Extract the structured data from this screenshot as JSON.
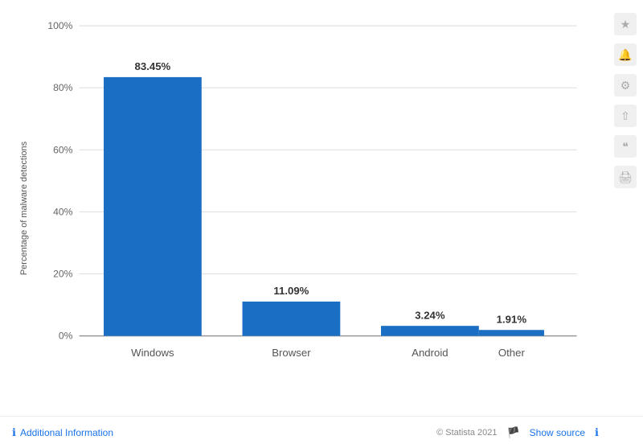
{
  "chart": {
    "title": "Percentage of malware detections",
    "y_axis_label": "Percentage of malware detections",
    "y_axis_ticks": [
      "0%",
      "20%",
      "40%",
      "60%",
      "80%",
      "100%"
    ],
    "bars": [
      {
        "label": "Windows",
        "value": 83.45,
        "display": "83.45%",
        "color": "#1a6fc4"
      },
      {
        "label": "Browser",
        "value": 11.09,
        "display": "11.09%",
        "color": "#1a6fc4"
      },
      {
        "label": "Android",
        "value": 3.24,
        "display": "3.24%",
        "color": "#1a6fc4"
      },
      {
        "label": "Other",
        "value": 1.91,
        "display": "1.91%",
        "color": "#1a6fc4"
      }
    ]
  },
  "footer": {
    "statista_label": "© Statista 2021",
    "additional_info": "Additional Information",
    "show_source": "Show source"
  },
  "sidebar": {
    "icons": [
      "★",
      "🔔",
      "⚙",
      "⇧",
      "❝",
      "🖨"
    ]
  }
}
